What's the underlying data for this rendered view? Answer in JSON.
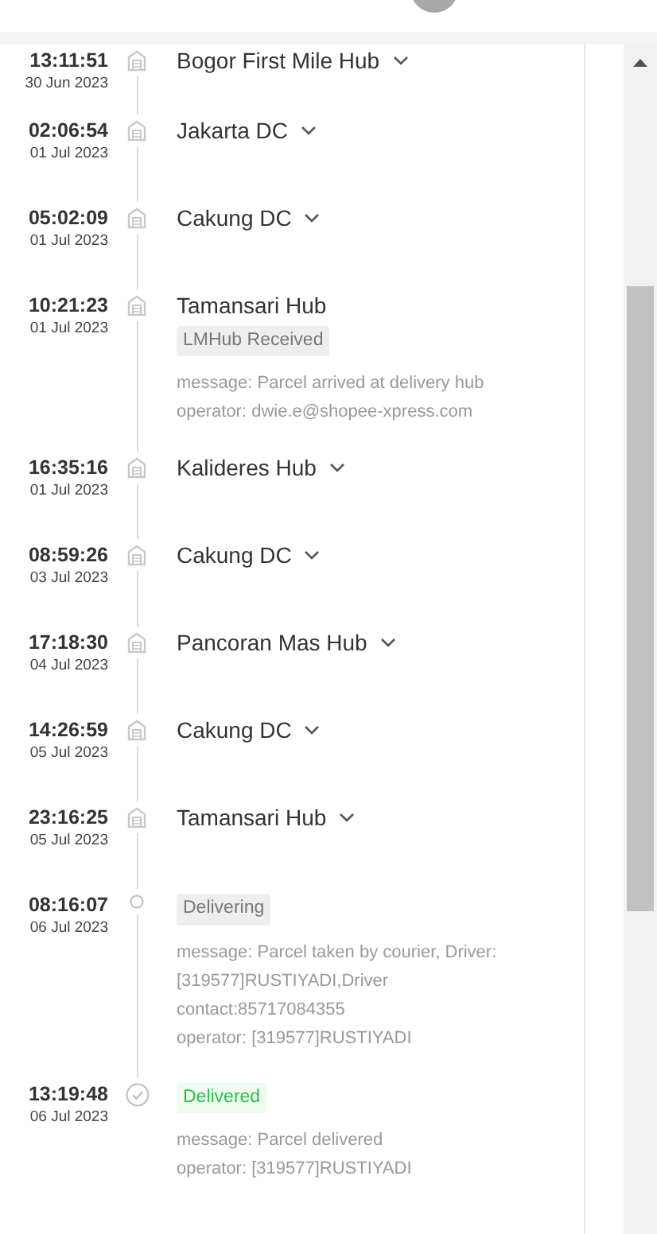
{
  "events": [
    {
      "time": "13:11:51",
      "date": "30 Jun 2023",
      "kind": "hub",
      "title": "Bogor First Mile Hub",
      "expanded": false
    },
    {
      "time": "02:06:54",
      "date": "01 Jul 2023",
      "kind": "hub",
      "title": "Jakarta DC",
      "expanded": false
    },
    {
      "time": "05:02:09",
      "date": "01 Jul 2023",
      "kind": "hub",
      "title": "Cakung DC",
      "expanded": false
    },
    {
      "time": "10:21:23",
      "date": "01 Jul 2023",
      "kind": "hub",
      "title": "Tamansari Hub",
      "expanded": true,
      "tag": "LMHub Received",
      "lines": [
        "message: Parcel arrived at delivery hub",
        "operator: dwie.e@shopee-xpress.com"
      ]
    },
    {
      "time": "16:35:16",
      "date": "01 Jul 2023",
      "kind": "hub",
      "title": "Kalideres Hub",
      "expanded": false
    },
    {
      "time": "08:59:26",
      "date": "03 Jul 2023",
      "kind": "hub",
      "title": "Cakung DC",
      "expanded": false
    },
    {
      "time": "17:18:30",
      "date": "04 Jul 2023",
      "kind": "hub",
      "title": "Pancoran Mas Hub",
      "expanded": false
    },
    {
      "time": "14:26:59",
      "date": "05 Jul 2023",
      "kind": "hub",
      "title": "Cakung DC",
      "expanded": false
    },
    {
      "time": "23:16:25",
      "date": "05 Jul 2023",
      "kind": "hub",
      "title": "Tamansari Hub",
      "expanded": false
    },
    {
      "time": "08:16:07",
      "date": "06 Jul 2023",
      "kind": "pending",
      "expanded": true,
      "tag": "Delivering",
      "lines": [
        "message: Parcel taken by courier, Driver: [319577]RUSTIYADI,Driver contact:85717084355",
        "operator: [319577]RUSTIYADI"
      ]
    },
    {
      "time": "13:19:48",
      "date": "06 Jul 2023",
      "kind": "done",
      "expanded": true,
      "tag": "Delivered",
      "lines": [
        "message: Parcel delivered",
        "operator: [319577]RUSTIYADI"
      ]
    }
  ]
}
